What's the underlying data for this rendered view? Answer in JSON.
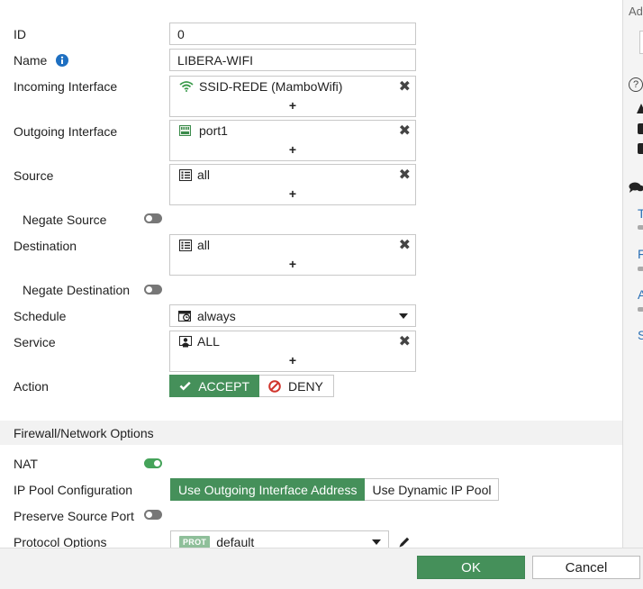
{
  "form": {
    "id": {
      "label": "ID",
      "value": "0"
    },
    "name": {
      "label": "Name",
      "value": "LIBERA-WIFI"
    },
    "incoming": {
      "label": "Incoming Interface",
      "entry": "SSID-REDE (MamboWifi)",
      "remove": "✖",
      "add": "+"
    },
    "outgoing": {
      "label": "Outgoing Interface",
      "entry": "port1",
      "remove": "✖",
      "add": "+"
    },
    "source": {
      "label": "Source",
      "entry": "all",
      "remove": "✖",
      "add": "+"
    },
    "negate_source": {
      "label": "Negate Source",
      "enabled": false
    },
    "destination": {
      "label": "Destination",
      "entry": "all",
      "remove": "✖",
      "add": "+"
    },
    "negate_destination": {
      "label": "Negate Destination",
      "enabled": false
    },
    "schedule": {
      "label": "Schedule",
      "value": "always"
    },
    "service": {
      "label": "Service",
      "entry": "ALL",
      "remove": "✖",
      "add": "+"
    },
    "action": {
      "label": "Action",
      "accept": "ACCEPT",
      "deny": "DENY",
      "selected": "ACCEPT"
    }
  },
  "firewall_options": {
    "header": "Firewall/Network Options",
    "nat": {
      "label": "NAT",
      "enabled": true
    },
    "ip_pool": {
      "label": "IP Pool Configuration",
      "option_outgoing": "Use Outgoing Interface Address",
      "option_dynamic": "Use Dynamic IP Pool",
      "selected": "Use Outgoing Interface Address"
    },
    "preserve_port": {
      "label": "Preserve Source Port",
      "enabled": false
    },
    "protocol_options": {
      "label": "Protocol Options",
      "badge": "PROT",
      "value": "default"
    }
  },
  "right_panel": {
    "header_fragment": "Ad",
    "help_icon": "?",
    "links": [
      "T",
      "F",
      "A",
      "S"
    ]
  },
  "footer": {
    "ok": "OK",
    "cancel": "Cancel"
  },
  "colors": {
    "accent": "#45905a",
    "toggle_on": "#45a35a",
    "link": "#2a6fb5",
    "info": "#1e6fc1"
  }
}
